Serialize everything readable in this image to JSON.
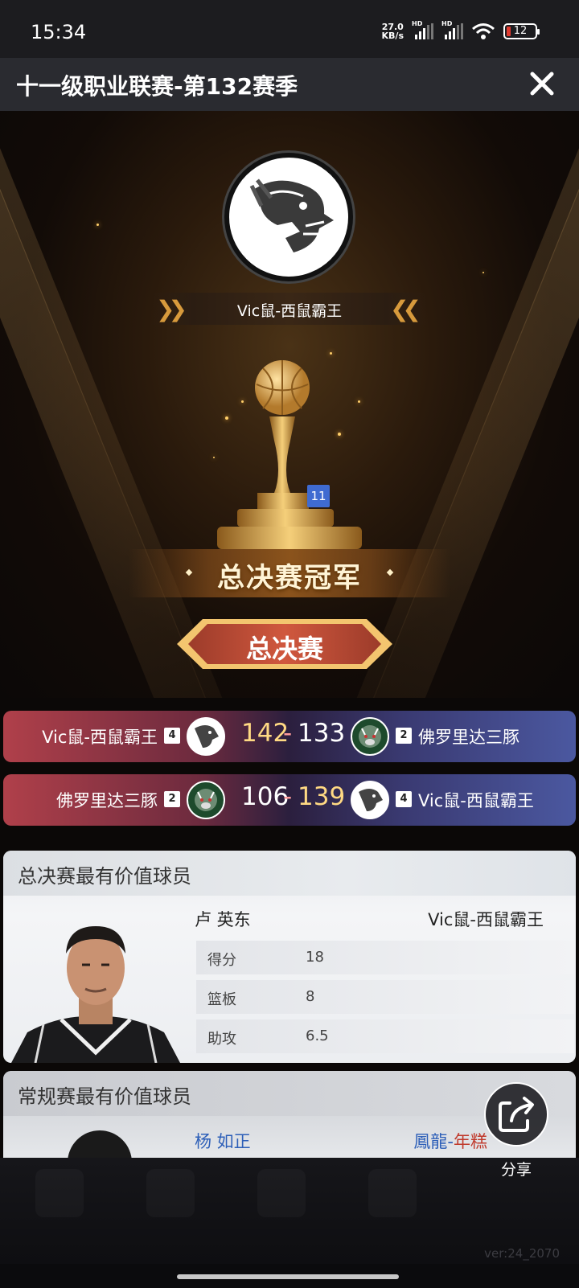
{
  "status_bar": {
    "time": "15:34",
    "net_speed_value": "27.0",
    "net_speed_unit": "KB/s",
    "sim1_label": "HD",
    "sim2_label": "HD",
    "battery_level": "12"
  },
  "header": {
    "title": "十一级职业联赛-第132赛季",
    "close_icon": "close-icon"
  },
  "champion": {
    "team_name": "Vic鼠-西鼠霸王",
    "trophy_level": "11",
    "banner_text": "总决赛冠军",
    "stage_tab": "总决赛"
  },
  "games": [
    {
      "left_team": "Vic鼠-西鼠霸王",
      "left_seed": "4",
      "left_score": "142",
      "right_score": "133",
      "right_seed": "2",
      "right_team": "佛罗里达三豚",
      "separator": "-"
    },
    {
      "left_team": "佛罗里达三豚",
      "left_seed": "2",
      "left_score": "106",
      "right_score": "139",
      "right_seed": "4",
      "right_team": "Vic鼠-西鼠霸王",
      "separator": "-"
    }
  ],
  "finals_mvp": {
    "section_title": "总决赛最有价值球员",
    "player_name": "卢 英东",
    "team": "Vic鼠-西鼠霸王",
    "stats": [
      {
        "label": "得分",
        "value": "18"
      },
      {
        "label": "篮板",
        "value": "8"
      },
      {
        "label": "助攻",
        "value": "6.5"
      }
    ]
  },
  "regular_mvp": {
    "section_title": "常规赛最有价值球员",
    "player_name": "杨 如正",
    "team_part1": "鳳龍-",
    "team_part2": "年糕"
  },
  "share": {
    "label": "分享"
  },
  "version": "ver:24_2070",
  "colors": {
    "win_score": "#ffd983",
    "accent_gold": "#d79a3c",
    "trophy_badge": "#3f6bd1"
  }
}
